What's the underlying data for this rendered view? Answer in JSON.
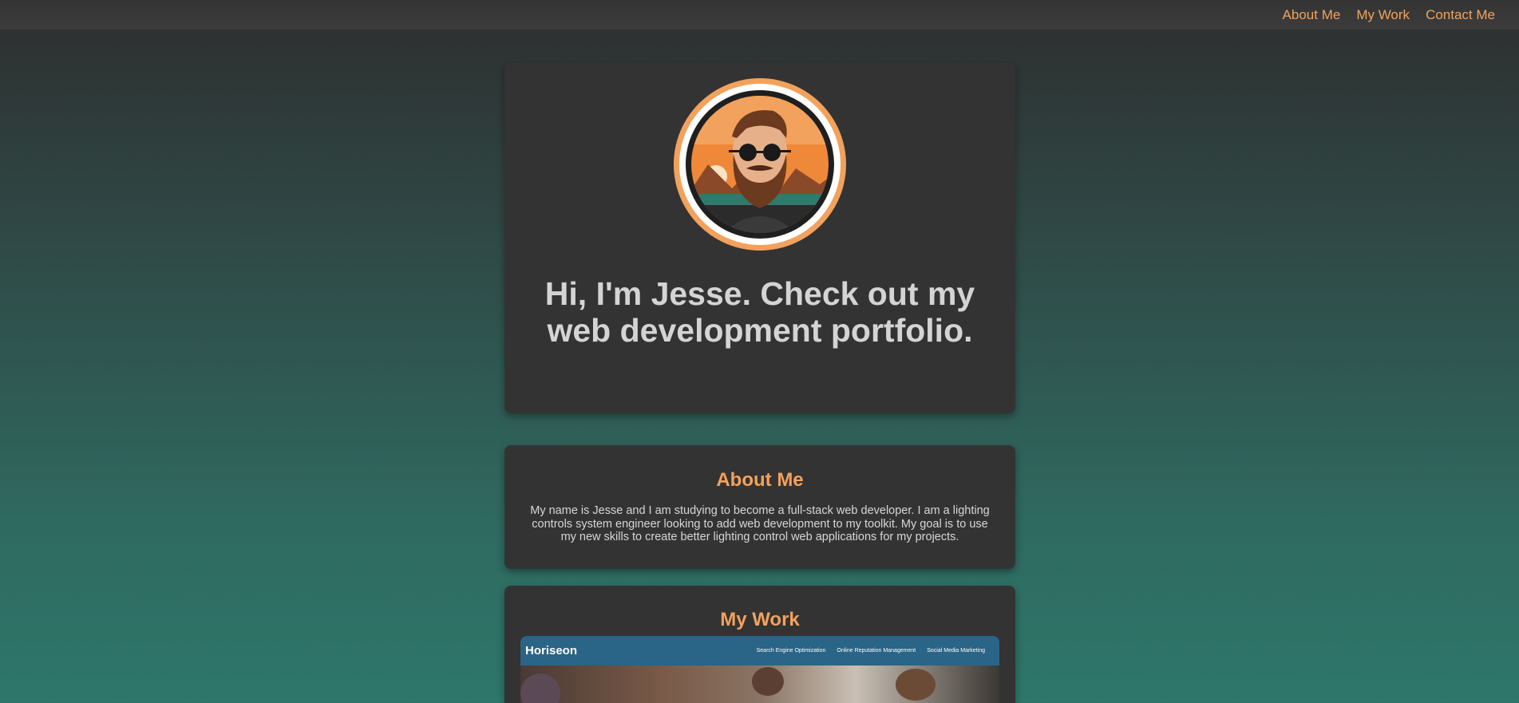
{
  "nav": {
    "items": [
      {
        "label": "About Me"
      },
      {
        "label": "My Work"
      },
      {
        "label": "Contact Me"
      }
    ]
  },
  "hero": {
    "avatar_icon": "bearded-man-avatar",
    "title": "Hi, I'm Jesse. Check out my web development portfolio."
  },
  "about": {
    "title": "About Me",
    "text": "My name is Jesse and I am studying to become a full-stack web developer. I am a lighting controls system engineer looking to add web development to my toolkit. My goal is to use my new skills to create better lighting control web applications for my projects."
  },
  "work": {
    "title": "My Work",
    "project": {
      "brand": "Horiseon",
      "nav": [
        "Search Engine Optimization",
        "Online Reputation Management",
        "Social Media Marketing"
      ]
    }
  },
  "colors": {
    "accent": "#f2a25c",
    "card": "#333333",
    "project_header": "#2a6486"
  }
}
